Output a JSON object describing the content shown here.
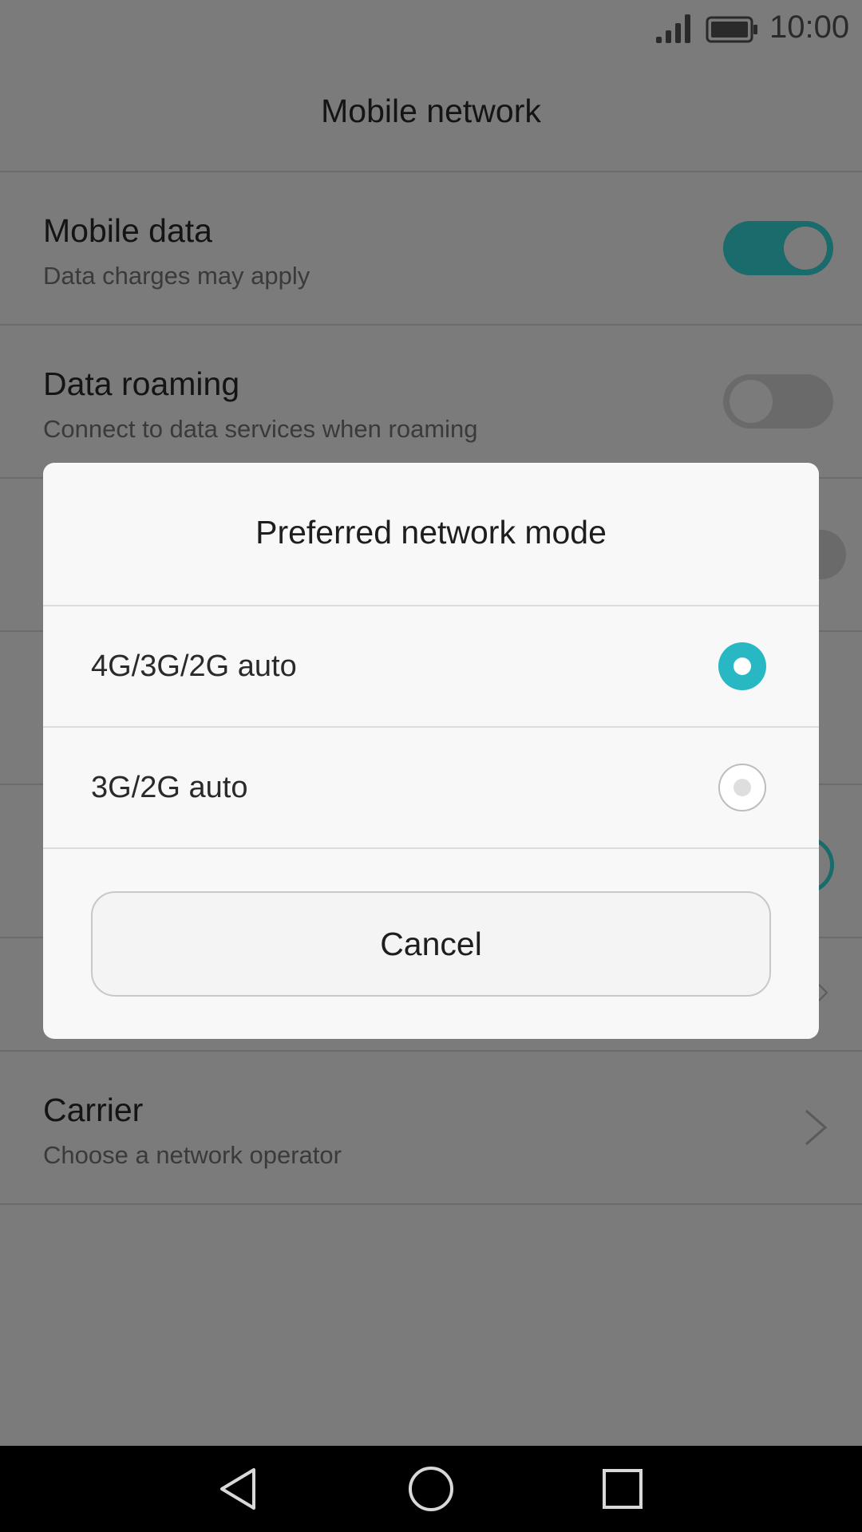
{
  "status_bar": {
    "time": "10:00",
    "icons": [
      "signal-icon",
      "battery-icon"
    ]
  },
  "header": {
    "title": "Mobile network"
  },
  "settings": {
    "mobile_data": {
      "title": "Mobile data",
      "subtitle": "Data charges may apply",
      "enabled": true
    },
    "data_roaming": {
      "title": "Data roaming",
      "subtitle": "Connect to data services when roaming",
      "enabled": false
    },
    "carrier": {
      "title": "Carrier",
      "subtitle": "Choose a network operator",
      "icon": "chevron-right-icon"
    }
  },
  "dialog": {
    "title": "Preferred network mode",
    "options": [
      {
        "label": "4G/3G/2G auto",
        "selected": true
      },
      {
        "label": "3G/2G auto",
        "selected": false
      }
    ],
    "cancel_label": "Cancel"
  },
  "nav_bar": {
    "icons": [
      "back-icon",
      "home-icon",
      "recents-icon"
    ]
  },
  "colors": {
    "accent": "#27b8c4",
    "scrim": "#7b7b7b",
    "dialog_bg": "#f8f8f8"
  }
}
